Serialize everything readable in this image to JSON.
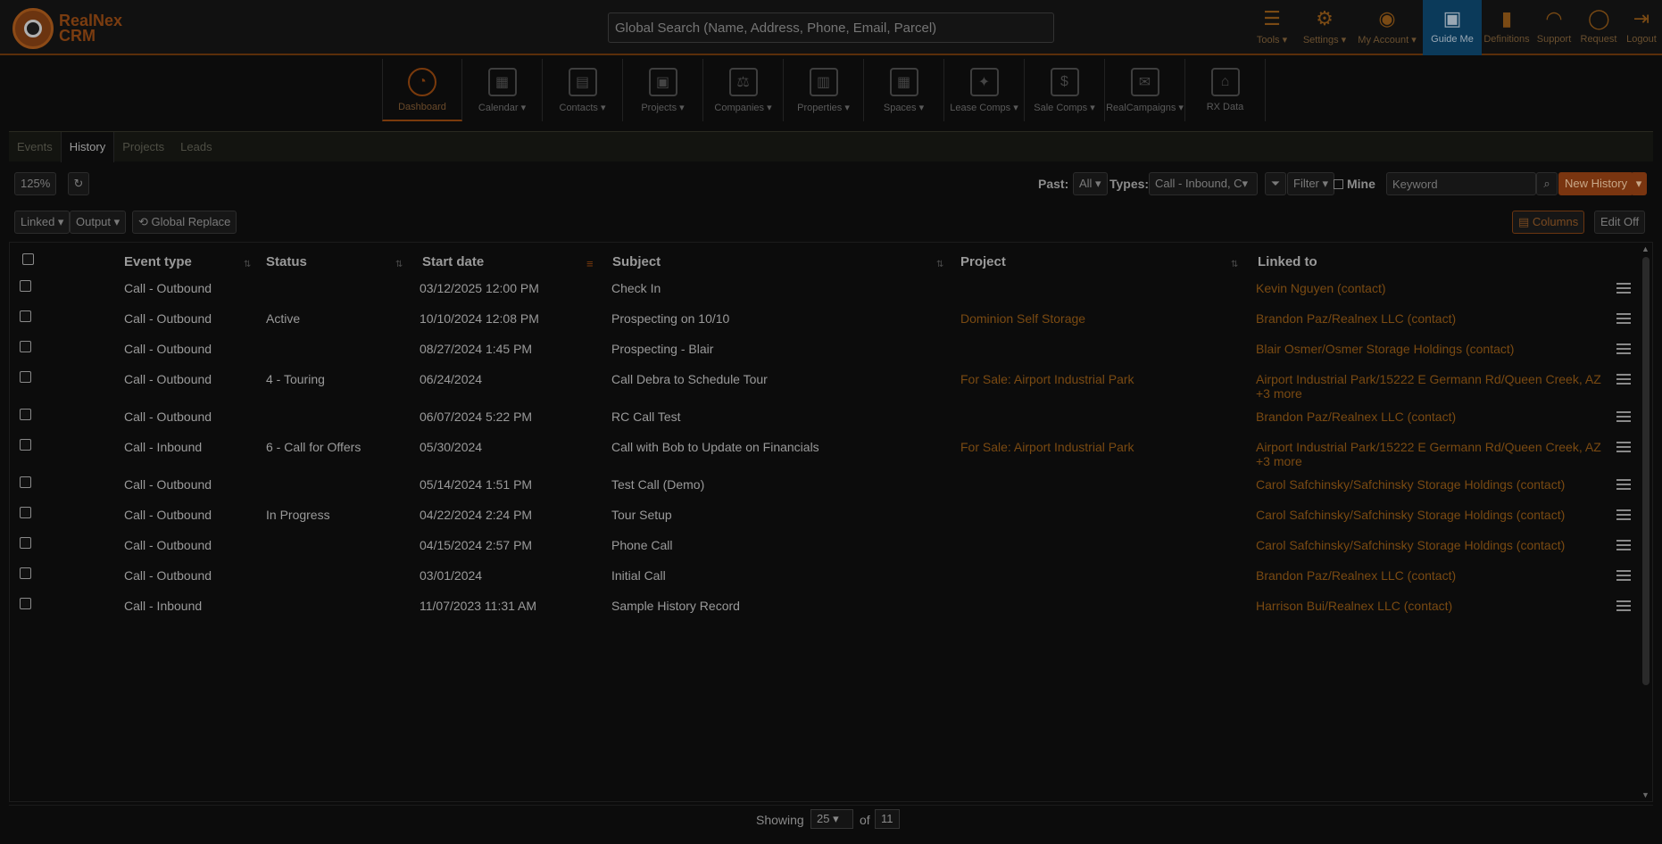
{
  "header": {
    "logo_line1": "RealNex",
    "logo_line2": "CRM",
    "search_placeholder": "Global Search (Name, Address, Phone, Email, Parcel)",
    "tools": [
      {
        "label": "Tools ▾",
        "icon": "list-icon"
      },
      {
        "label": "Settings ▾",
        "icon": "gear-icon"
      },
      {
        "label": "My Account ▾",
        "icon": "user-icon"
      },
      {
        "label": "Guide Me",
        "icon": "guide-icon",
        "active": true
      },
      {
        "label": "Definitions",
        "icon": "book-icon"
      },
      {
        "label": "Support",
        "icon": "headset-icon"
      },
      {
        "label": "Request",
        "icon": "lightbulb-icon"
      },
      {
        "label": "Logout",
        "icon": "logout-icon"
      }
    ]
  },
  "modules": [
    {
      "label": "Dashboard",
      "icon": "dashboard-icon",
      "active": true
    },
    {
      "label": "Calendar ▾",
      "icon": "calendar-icon"
    },
    {
      "label": "Contacts ▾",
      "icon": "contacts-icon"
    },
    {
      "label": "Projects ▾",
      "icon": "projects-icon"
    },
    {
      "label": "Companies ▾",
      "icon": "companies-icon"
    },
    {
      "label": "Properties ▾",
      "icon": "properties-icon"
    },
    {
      "label": "Spaces ▾",
      "icon": "spaces-icon"
    },
    {
      "label": "Lease Comps ▾",
      "icon": "lease-comps-icon"
    },
    {
      "label": "Sale Comps ▾",
      "icon": "sale-comps-icon"
    },
    {
      "label": "RealCampaigns ▾",
      "icon": "campaigns-icon"
    },
    {
      "label": "RX Data",
      "icon": "rx-data-icon"
    }
  ],
  "tabs": [
    {
      "label": "Events"
    },
    {
      "label": "History",
      "active": true
    },
    {
      "label": "Projects"
    },
    {
      "label": "Leads"
    }
  ],
  "toolbar": {
    "zoom": "125%",
    "past_label": "Past:",
    "past_value": "All ▾",
    "types_label": "Types:",
    "types_value": "Call - Inbound, C▾",
    "filter_label": "Filter ▾",
    "mine_label": "Mine",
    "keyword_placeholder": "Keyword",
    "new_history": "New History",
    "linked": "Linked ▾",
    "output": "Output ▾",
    "global_replace": "Global Replace",
    "columns": "Columns",
    "edit_off": "Edit Off"
  },
  "table": {
    "columns": [
      "Event type",
      "Status",
      "Start date",
      "Subject",
      "Project",
      "Linked to"
    ],
    "rows": [
      {
        "event_type": "Call - Outbound",
        "status": "",
        "start": "03/12/2025 12:00 PM",
        "subject": "Check In",
        "project": "",
        "linked": "Kevin Nguyen (contact)",
        "more": ""
      },
      {
        "event_type": "Call - Outbound",
        "status": "Active",
        "start": "10/10/2024 12:08 PM",
        "subject": "Prospecting on 10/10",
        "project": "Dominion Self Storage",
        "linked": "Brandon Paz/Realnex LLC (contact)",
        "more": ""
      },
      {
        "event_type": "Call - Outbound",
        "status": "",
        "start": "08/27/2024 1:45 PM",
        "subject": "Prospecting - Blair",
        "project": "",
        "linked": "Blair Osmer/Osmer Storage Holdings (contact)",
        "more": ""
      },
      {
        "event_type": "Call - Outbound",
        "status": "4 - Touring",
        "start": "06/24/2024",
        "subject": "Call Debra to Schedule Tour",
        "project": "For Sale: Airport Industrial Park",
        "linked": "Airport Industrial Park/15222 E Germann Rd/Queen Creek, AZ",
        "more": "+3 more"
      },
      {
        "event_type": "Call - Outbound",
        "status": "",
        "start": "06/07/2024 5:22 PM",
        "subject": "RC Call Test",
        "project": "",
        "linked": "Brandon Paz/Realnex LLC (contact)",
        "more": ""
      },
      {
        "event_type": "Call - Inbound",
        "status": "6 - Call for Offers",
        "start": "05/30/2024",
        "subject": "Call with Bob to Update on Financials",
        "project": "For Sale: Airport Industrial Park",
        "linked": "Airport Industrial Park/15222 E Germann Rd/Queen Creek, AZ",
        "more": "+3 more"
      },
      {
        "event_type": "Call - Outbound",
        "status": "",
        "start": "05/14/2024 1:51 PM",
        "subject": "Test Call (Demo)",
        "project": "",
        "linked": "Carol Safchinsky/Safchinsky Storage Holdings (contact)",
        "more": ""
      },
      {
        "event_type": "Call - Outbound",
        "status": "In Progress",
        "start": "04/22/2024 2:24 PM",
        "subject": "Tour Setup",
        "project": "",
        "linked": "Carol Safchinsky/Safchinsky Storage Holdings (contact)",
        "more": ""
      },
      {
        "event_type": "Call - Outbound",
        "status": "",
        "start": "04/15/2024 2:57 PM",
        "subject": "Phone Call",
        "project": "",
        "linked": "Carol Safchinsky/Safchinsky Storage Holdings (contact)",
        "more": ""
      },
      {
        "event_type": "Call - Outbound",
        "status": "",
        "start": "03/01/2024",
        "subject": "Initial Call",
        "project": "",
        "linked": "Brandon Paz/Realnex LLC (contact)",
        "more": ""
      },
      {
        "event_type": "Call - Inbound",
        "status": "",
        "start": "11/07/2023 11:31 AM",
        "subject": "Sample History Record",
        "project": "",
        "linked": "Harrison Bui/Realnex LLC (contact)",
        "more": ""
      }
    ]
  },
  "footer": {
    "showing_label": "Showing",
    "page_size": "25",
    "of_label": "of",
    "total": "11"
  },
  "colors": {
    "accent": "#7a3510",
    "link": "#7a4a12",
    "guide_active": "#0b3a5a"
  }
}
